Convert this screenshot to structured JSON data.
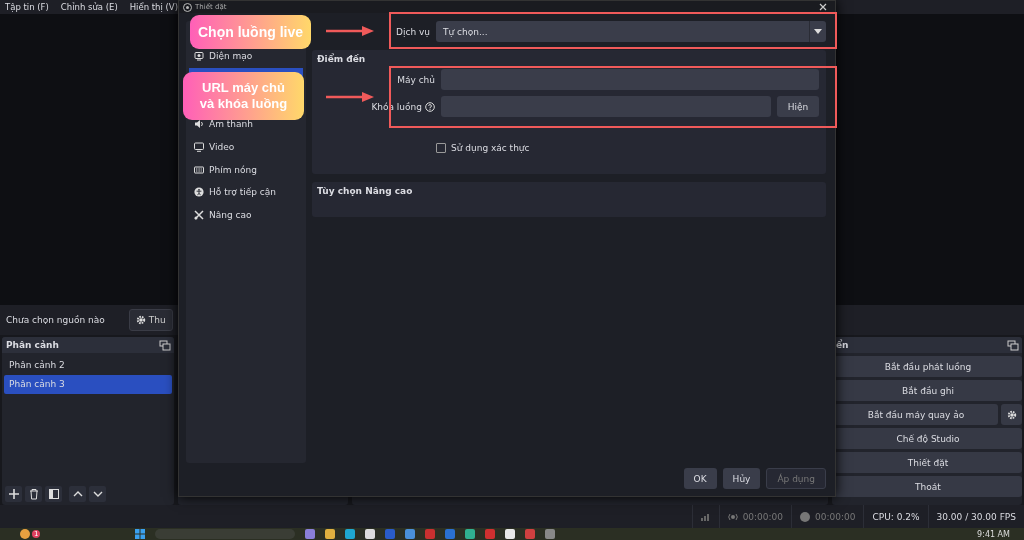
{
  "main_menu": [
    "Tập tin (F)",
    "Chỉnh sửa (E)",
    "Hiển thị (V)"
  ],
  "source_bar": {
    "label": "Chưa chọn nguồn nào",
    "properties_button": "Thu"
  },
  "scenes": {
    "title": "Phân cảnh",
    "items": [
      {
        "label": "Phân cảnh 2",
        "selected": false
      },
      {
        "label": "Phân cảnh 3",
        "selected": true
      }
    ]
  },
  "controls": {
    "title": "ển",
    "buttons": [
      {
        "label": "Bắt đầu phát luồng",
        "has_settings": false
      },
      {
        "label": "Bắt đầu ghi",
        "has_settings": false
      },
      {
        "label": "Bắt đầu máy quay ảo",
        "has_settings": true
      },
      {
        "label": "Chế độ Studio",
        "has_settings": false
      },
      {
        "label": "Thiết đặt",
        "has_settings": false
      },
      {
        "label": "Thoát",
        "has_settings": false
      }
    ]
  },
  "status_bar": {
    "stream_time": "00:00:00",
    "record_time": "00:00:00",
    "cpu": "CPU: 0.2%",
    "fps": "30.00 / 30.00 FPS"
  },
  "settings_dialog": {
    "title": "Thiết đặt",
    "sidebar": [
      {
        "label": "Diện mạo",
        "selected": false
      },
      {
        "selected": true
      },
      {
        "label": "Âm thanh",
        "selected": false
      },
      {
        "label": "Video",
        "selected": false
      },
      {
        "label": "Phím nóng",
        "selected": false
      },
      {
        "label": "Hỗ trợ tiếp cận",
        "selected": false
      },
      {
        "label": "Nâng cao",
        "selected": false
      }
    ],
    "service": {
      "label": "Dịch vụ",
      "value": "Tự chọn..."
    },
    "destination": {
      "title": "Điểm đến",
      "server_label": "Máy chủ",
      "key_label": "Khóa luồng",
      "show_button": "Hiện"
    },
    "use_auth": {
      "label": "Sử dụng xác thực",
      "checked": false
    },
    "advanced": {
      "title": "Tùy chọn Nâng cao"
    },
    "buttons": [
      {
        "label": "OK",
        "disabled": false
      },
      {
        "label": "Hủy",
        "disabled": false
      },
      {
        "label": "Áp dụng",
        "disabled": true
      }
    ]
  },
  "annotations": [
    {
      "text": "Chọn luồng live"
    },
    {
      "text": "URL máy chủ\nvà khóa luồng"
    }
  ],
  "taskbar": {
    "notification_count": "1",
    "clock": "9:41 AM"
  }
}
